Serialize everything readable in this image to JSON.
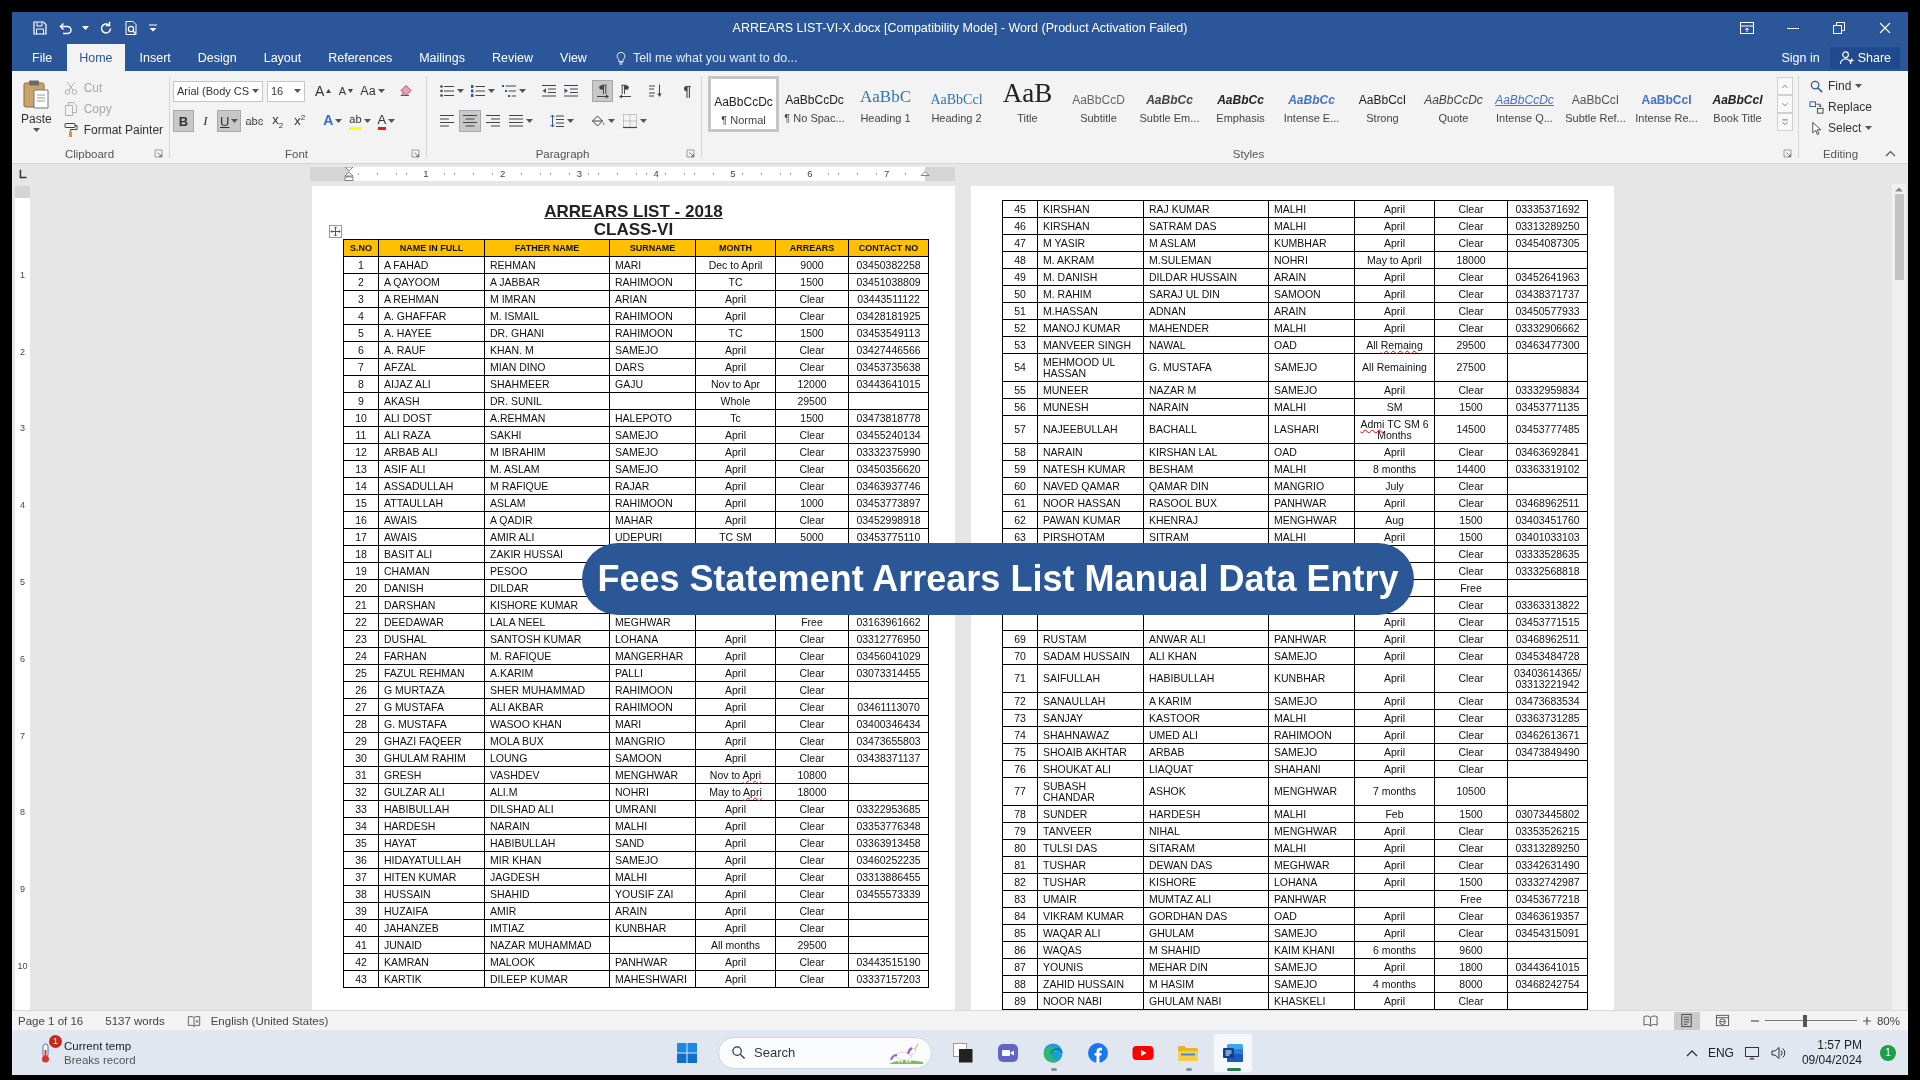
{
  "window": {
    "title": "ARREARS LIST-VI-X.docx [Compatibility Mode] - Word (Product Activation Failed)"
  },
  "ribbon_tabs": [
    {
      "label": "File",
      "selected": false
    },
    {
      "label": "Home",
      "selected": true
    },
    {
      "label": "Insert",
      "selected": false
    },
    {
      "label": "Design",
      "selected": false
    },
    {
      "label": "Layout",
      "selected": false
    },
    {
      "label": "References",
      "selected": false
    },
    {
      "label": "Mailings",
      "selected": false
    },
    {
      "label": "Review",
      "selected": false
    },
    {
      "label": "View",
      "selected": false
    }
  ],
  "tell_me": {
    "placeholder": "Tell me what you want to do..."
  },
  "account": {
    "sign_in": "Sign in",
    "share": "Share"
  },
  "clipboard": {
    "label": "Clipboard",
    "paste": "Paste",
    "items": [
      {
        "kind": "cut",
        "label": "Cut",
        "disabled": true
      },
      {
        "kind": "copy",
        "label": "Copy",
        "disabled": true
      },
      {
        "kind": "painter",
        "label": "Format Painter",
        "disabled": false
      }
    ]
  },
  "font": {
    "label": "Font",
    "family": "Arial (Body CS",
    "size": "16",
    "size_buttons": [
      {
        "kind": "grow",
        "glyph": "A"
      },
      {
        "kind": "shrink",
        "glyph": "A"
      }
    ],
    "change_case": "Aa",
    "formats": [
      {
        "kind": "bold",
        "glyph": "B",
        "selected": true
      },
      {
        "kind": "italic",
        "glyph": "I",
        "selected": false
      },
      {
        "kind": "underline",
        "glyph": "U",
        "selected": true
      },
      {
        "kind": "strike",
        "glyph": "abc",
        "selected": false
      },
      {
        "kind": "subscript",
        "glyph": "x$_{2}$",
        "selected": false
      },
      {
        "kind": "superscript",
        "glyph": "x$^{2}$",
        "selected": false
      }
    ],
    "effects": [
      {
        "kind": "text_effects",
        "glyph": "A"
      },
      {
        "kind": "highlight",
        "glyph": "ab"
      },
      {
        "kind": "font_color",
        "glyph": "A"
      }
    ]
  },
  "paragraph": {
    "label": "Paragraph",
    "rows": [
      [
        {
          "kind": "bullets",
          "selected": false
        },
        {
          "kind": "numbering",
          "selected": false
        },
        {
          "kind": "multilevel",
          "selected": false
        },
        {
          "kind": "outdent",
          "selected": false
        },
        {
          "kind": "indent",
          "selected": false
        },
        {
          "kind": "ltr",
          "selected": true
        },
        {
          "kind": "rtl",
          "selected": false
        },
        {
          "kind": "sort",
          "selected": false
        },
        {
          "kind": "marks",
          "glyph": "¶",
          "selected": false
        }
      ],
      [
        {
          "kind": "align_left",
          "selected": false
        },
        {
          "kind": "align_center",
          "selected": true
        },
        {
          "kind": "align_right",
          "selected": false
        },
        {
          "kind": "justify",
          "selected": false
        },
        {
          "kind": "line_spacing",
          "selected": false
        },
        {
          "kind": "shading",
          "selected": false
        },
        {
          "kind": "borders",
          "selected": false
        }
      ]
    ]
  },
  "styles": {
    "label": "Styles",
    "items": [
      {
        "kind": "normal",
        "preview": "AaBbCcDc",
        "name": "¶ Normal",
        "selected": true
      },
      {
        "kind": "no_spacing",
        "preview": "AaBbCcDc",
        "name": "¶ No Spac...",
        "selected": false
      },
      {
        "kind": "heading1",
        "preview": "AaBbC",
        "name": "Heading 1",
        "selected": false
      },
      {
        "kind": "heading2",
        "preview": "AaBbCcl",
        "name": "Heading 2",
        "selected": false
      },
      {
        "kind": "title",
        "preview": "AaB",
        "name": "Title",
        "selected": false
      },
      {
        "kind": "subtitle",
        "preview": "AaBbCcD",
        "name": "Subtitle",
        "selected": false
      },
      {
        "kind": "subtle_emphasis",
        "preview": "AaBbCc",
        "name": "Subtle Em...",
        "selected": false
      },
      {
        "kind": "emphasis",
        "preview": "AaBbCc",
        "name": "Emphasis",
        "selected": false
      },
      {
        "kind": "intense_emphasis",
        "preview": "AaBbCc",
        "name": "Intense E...",
        "selected": false
      },
      {
        "kind": "strong",
        "preview": "AaBbCcI",
        "name": "Strong",
        "selected": false
      },
      {
        "kind": "quote",
        "preview": "AaBbCcDc",
        "name": "Quote",
        "selected": false
      },
      {
        "kind": "intense_quote",
        "preview": "AaBbCcDc",
        "name": "Intense Q...",
        "selected": false
      },
      {
        "kind": "subtle_reference",
        "preview": "AaBbCcI",
        "name": "Subtle Ref...",
        "selected": false
      },
      {
        "kind": "intense_reference",
        "preview": "AaBbCcI",
        "name": "Intense Re...",
        "selected": false
      },
      {
        "kind": "book_title",
        "preview": "AaBbCcl",
        "name": "Book Title",
        "selected": false
      }
    ]
  },
  "editing": {
    "label": "Editing",
    "items": [
      {
        "kind": "find",
        "label": "Find"
      },
      {
        "kind": "replace",
        "label": "Replace"
      },
      {
        "kind": "select",
        "label": "Select"
      }
    ]
  },
  "ruler": {
    "numbers": [
      "1",
      "2",
      "3",
      "4",
      "5",
      "6",
      "7"
    ]
  },
  "vertical_ruler": {
    "numbers": [
      "1",
      "2",
      "3",
      "4",
      "5",
      "6",
      "7",
      "8",
      "9",
      "10"
    ]
  },
  "pages": [
    {
      "title": "ARREARS LIST - 2018",
      "subtitle": "CLASS-VI",
      "columns": [
        "S.NO",
        "NAME IN FULL",
        "FATHER NAME",
        "SURNAME",
        "MONTH",
        "ARREARS",
        "CONTACT NO"
      ],
      "rows": [
        {
          "no": "1",
          "name": "A FAHAD",
          "father": "REHMAN",
          "surname": "MARI",
          "month": "Dec to April",
          "arrears": "9000",
          "contact": "03450382258"
        },
        {
          "no": "2",
          "name": "A QAYOOM",
          "father": "A JABBAR",
          "surname": "RAHIMOON",
          "month": "TC",
          "arrears": "1500",
          "contact": "03451038809"
        },
        {
          "no": "3",
          "name": "A REHMAN",
          "father": "M IMRAN",
          "surname": "ARIAN",
          "month": "April",
          "arrears": "Clear",
          "contact": "03443511122"
        },
        {
          "no": "4",
          "name": "A. GHAFFAR",
          "father": "M. ISMAIL",
          "surname": "RAHIMOON",
          "month": "April",
          "arrears": "Clear",
          "contact": "03428181925"
        },
        {
          "no": "5",
          "name": "A. HAYEE",
          "father": "DR. GHANI",
          "surname": "RAHIMOON",
          "month": "TC",
          "arrears": "1500",
          "contact": "03453549113"
        },
        {
          "no": "6",
          "name": "A. RAUF",
          "father": "KHAN. M",
          "surname": "SAMEJO",
          "month": "April",
          "arrears": "Clear",
          "contact": "03427446566"
        },
        {
          "no": "7",
          "name": "AFZAL",
          "father": "MIAN DINO",
          "surname": "DARS",
          "month": "April",
          "arrears": "Clear",
          "contact": "03453735638"
        },
        {
          "no": "8",
          "name": "AIJAZ ALI",
          "father": "SHAHMEER",
          "surname": "GAJU",
          "month": "Nov to Apr",
          "arrears": "12000",
          "contact": "03443641015"
        },
        {
          "no": "9",
          "name": "AKASH",
          "father": "DR. SUNIL",
          "month": "Whole",
          "arrears": "29500"
        },
        {
          "no": "10",
          "name": "ALI DOST",
          "father": "A.REHMAN",
          "surname": "HALEPOTO",
          "month": "Tc",
          "arrears": "1500",
          "contact": "03473818778"
        },
        {
          "no": "11",
          "name": "ALI RAZA",
          "father": "SAKHI",
          "surname": "SAMEJO",
          "month": "April",
          "arrears": "Clear",
          "contact": "03455240134"
        },
        {
          "no": "12",
          "name": "ARBAB ALI",
          "father": "M IBRAHIM",
          "surname": "SAMEJO",
          "month": "April",
          "arrears": "Clear",
          "contact": "03332375990"
        },
        {
          "no": "13",
          "name": "ASIF ALI",
          "father": "M. ASLAM",
          "surname": "SAMEJO",
          "month": "April",
          "arrears": "Clear",
          "contact": "03450356620"
        },
        {
          "no": "14",
          "name": "ASSADULLAH",
          "father": "M RAFIQUE",
          "surname": "RAJAR",
          "month": "April",
          "arrears": "Clear",
          "contact": "03463937746"
        },
        {
          "no": "15",
          "name": "ATTAULLAH",
          "father": "ASLAM",
          "surname": "RAHIMOON",
          "month": "April",
          "arrears": "1000",
          "contact": "03453773897"
        },
        {
          "no": "16",
          "name": "AWAIS",
          "father": "A QADIR",
          "surname": "MAHAR",
          "month": "April",
          "arrears": "Clear",
          "contact": "03452998918"
        },
        {
          "no": "17",
          "name": "AWAIS",
          "father": "AMIR ALI",
          "surname": "UDEPURI",
          "month": "TC SM",
          "arrears": "5000",
          "contact": "03453775110"
        },
        {
          "no": "18",
          "name": "BASIT ALI",
          "father": "ZAKIR HUSSAI"
        },
        {
          "no": "19",
          "name": "CHAMAN",
          "father": "PESOO"
        },
        {
          "no": "20",
          "name": "DANISH",
          "father": "DILDAR"
        },
        {
          "no": "21",
          "name": "DARSHAN",
          "father": "KISHORE KUMAR"
        },
        {
          "no": "22",
          "name": "DEEDAWAR",
          "father": "LALA NEEL",
          "surname": "MEGHWAR",
          "arrears": "Free",
          "contact": "03163961662"
        },
        {
          "no": "23",
          "name": "DUSHAL",
          "father": "SANTOSH KUMAR",
          "surname": "LOHANA",
          "month": "April",
          "arrears": "Clear",
          "contact": "03312776950"
        },
        {
          "no": "24",
          "name": "FARHAN",
          "father": "M. RAFIQUE",
          "surname": "MANGERHAR",
          "month": "April",
          "arrears": "Clear",
          "contact": "03456041029"
        },
        {
          "no": "25",
          "name": "FAZUL REHMAN",
          "father": "A.KARIM",
          "surname": "PALLI",
          "month": "April",
          "arrears": "Clear",
          "contact": "03073314455"
        },
        {
          "no": "26",
          "name": "G MURTAZA",
          "father": "SHER MUHAMMAD",
          "surname": "RAHIMOON",
          "month": "April",
          "arrears": "Clear"
        },
        {
          "no": "27",
          "name": "G MUSTAFA",
          "father": "ALI AKBAR",
          "surname": "RAHIMOON",
          "month": "April",
          "arrears": "Clear",
          "contact": "03461113070"
        },
        {
          "no": "28",
          "name": "G. MUSTAFA",
          "father": "WASOO KHAN",
          "surname": "MARI",
          "month": "April",
          "arrears": "Clear",
          "contact": "03400346434"
        },
        {
          "no": "29",
          "name": "GHAZI FAQEER",
          "father": "MOLA BUX",
          "surname": "MANGRIO",
          "month": "April",
          "arrears": "Clear",
          "contact": "03473655803"
        },
        {
          "no": "30",
          "name": "GHULAM RAHIM",
          "father": "LOUNG",
          "surname": "SAMOON",
          "month": "April",
          "arrears": "Clear",
          "contact": "03438371137"
        },
        {
          "no": "31",
          "name": "GRESH",
          "father": "VASHDEV",
          "surname": "MENGHWAR",
          "month": [
            {
              "text": "Nov to",
              "misspelled": false
            },
            {
              "text": "Apri",
              "misspelled": true
            }
          ],
          "arrears": "10800"
        },
        {
          "no": "32",
          "name": "GULZAR ALI",
          "father": "ALI.M",
          "surname": "NOHRI",
          "month": [
            {
              "text": "May to",
              "misspelled": false
            },
            {
              "text": "Apri",
              "misspelled": true
            }
          ],
          "arrears": "18000"
        },
        {
          "no": "33",
          "name": "HABIBULLAH",
          "father": "DILSHAD ALI",
          "surname": "UMRANI",
          "month": "April",
          "arrears": "Clear",
          "contact": "03322953685"
        },
        {
          "no": "34",
          "name": "HARDESH",
          "father": "NARAIN",
          "surname": "MALHI",
          "month": "April",
          "arrears": "Clear",
          "contact": "03353776348"
        },
        {
          "no": "35",
          "name": "HAYAT",
          "father": "HABIBULLAH",
          "surname": "SAND",
          "month": "April",
          "arrears": "Clear",
          "contact": "03363913458"
        },
        {
          "no": "36",
          "name": "HIDAYATULLAH",
          "father": "MIR KHAN",
          "surname": "SAMEJO",
          "month": "April",
          "arrears": "Clear",
          "contact": "03460252235"
        },
        {
          "no": "37",
          "name": "HITEN KUMAR",
          "father": "JAGDESH",
          "surname": "MALHI",
          "month": "April",
          "arrears": "Clear",
          "contact": "03313886455"
        },
        {
          "no": "38",
          "name": "HUSSAIN",
          "father": "SHAHID",
          "surname": "YOUSIF ZAI",
          "month": "April",
          "arrears": "Clear",
          "contact": "03455573339"
        },
        {
          "no": "39",
          "name": "HUZAIFA",
          "father": "AMIR",
          "surname": "ARAIN",
          "month": "April",
          "arrears": "Clear"
        },
        {
          "no": "40",
          "name": "JAHANZEB",
          "father": "IMTIAZ",
          "surname": "KUNBHAR",
          "month": "April",
          "arrears": "Clear"
        },
        {
          "no": "41",
          "name": "JUNAID",
          "father": "NAZAR MUHAMMAD",
          "month": "All months",
          "arrears": "29500"
        },
        {
          "no": "42",
          "name": "KAMRAN",
          "father": "MALOOK",
          "surname": "PANHWAR",
          "month": "April",
          "arrears": "Clear",
          "contact": "03443515190"
        },
        {
          "no": "43",
          "name": "KARTIK",
          "father": "DILEEP KUMAR",
          "surname": "MAHESHWARI",
          "month": "April",
          "arrears": "Clear",
          "contact": "03337157203"
        }
      ]
    },
    {
      "rows": [
        {
          "no": "45",
          "name": "KIRSHAN",
          "father": "RAJ KUMAR",
          "surname": "MALHI",
          "month": "April",
          "arrears": "Clear",
          "contact": "03335371692"
        },
        {
          "no": "46",
          "name": "KIRSHAN",
          "father": "SATRAM DAS",
          "surname": "MALHI",
          "month": "April",
          "arrears": "Clear",
          "contact": "03313289250"
        },
        {
          "no": "47",
          "name": "M YASIR",
          "father": "M ASLAM",
          "surname": "KUMBHAR",
          "month": "April",
          "arrears": "Clear",
          "contact": "03454087305"
        },
        {
          "no": "48",
          "name": "M. AKRAM",
          "father": "M.SULEMAN",
          "surname": "NOHRI",
          "month": "May to April",
          "arrears": "18000"
        },
        {
          "no": "49",
          "name": "M. DANISH",
          "father": "DILDAR HUSSAIN",
          "surname": "ARAIN",
          "month": "April",
          "arrears": "Clear",
          "contact": "03452641963"
        },
        {
          "no": "50",
          "name": "M. RAHIM",
          "father": "SARAJ UL DIN",
          "surname": "SAMOON",
          "month": "April",
          "arrears": "Clear",
          "contact": "03438371737"
        },
        {
          "no": "51",
          "name": "M.HASSAN",
          "father": "ADNAN",
          "surname": "ARAIN",
          "month": "April",
          "arrears": "Clear",
          "contact": "03450577933"
        },
        {
          "no": "52",
          "name": "MANOJ KUMAR",
          "father": "MAHENDER",
          "surname": "MALHI",
          "month": "April",
          "arrears": "Clear",
          "contact": "03332906662"
        },
        {
          "no": "53",
          "name": "MANVEER SINGH",
          "father": "NAWAL",
          "surname": "OAD",
          "month": [
            {
              "text": "All",
              "misspelled": false
            },
            {
              "text": "Remaing",
              "misspelled": true
            }
          ],
          "arrears": "29500",
          "contact": "03463477300"
        },
        {
          "no": "54",
          "name": "MEHMOOD UL HASSAN",
          "father": "G. MUSTAFA",
          "surname": "SAMEJO",
          "month": "All Remaining",
          "arrears": "27500"
        },
        {
          "no": "55",
          "name": "MUNEER",
          "father": "NAZAR M",
          "surname": "SAMEJO",
          "month": "April",
          "arrears": "Clear",
          "contact": "03332959834"
        },
        {
          "no": "56",
          "name": "MUNESH",
          "father": "NARAIN",
          "surname": "MALHI",
          "month": "SM",
          "arrears": "1500",
          "contact": "03453771135"
        },
        {
          "no": "57",
          "name": "NAJEEBULLAH",
          "father": "BACHALL",
          "surname": "LASHARI",
          "month": [
            {
              "text": "Admi",
              "misspelled": true
            },
            {
              "text": "TC SM 6 Months",
              "misspelled": false
            }
          ],
          "arrears": "14500",
          "contact": "03453777485"
        },
        {
          "no": "58",
          "name": "NARAIN",
          "father": "KIRSHAN LAL",
          "surname": "OAD",
          "month": "April",
          "arrears": "Clear",
          "contact": "03463692841"
        },
        {
          "no": "59",
          "name": "NATESH KUMAR",
          "father": "BESHAM",
          "surname": "MALHI",
          "month": "8 months",
          "arrears": "14400",
          "contact": "03363319102"
        },
        {
          "no": "60",
          "name": "NAVED QAMAR",
          "father": "QAMAR DIN",
          "surname": "MANGRIO",
          "month": "July",
          "arrears": "Clear"
        },
        {
          "no": "61",
          "name": "NOOR HASSAN",
          "father": "RASOOL BUX",
          "surname": "PANHWAR",
          "month": "April",
          "arrears": "Clear",
          "contact": "03468962511"
        },
        {
          "no": "62",
          "name": "PAWAN KUMAR",
          "father": "KHENRAJ",
          "surname": "MENGHWAR",
          "month": "Aug",
          "arrears": "1500",
          "contact": "03403451760"
        },
        {
          "no": "63",
          "name": "PIRSHOTAM",
          "father": "SITRAM",
          "surname": "MALHI",
          "month": "April",
          "arrears": "1500",
          "contact": "03401033103"
        },
        {
          "arrears": "Clear",
          "contact": "03333528635"
        },
        {
          "arrears": "Clear",
          "contact": "03332568818"
        },
        {
          "arrears": "Free"
        },
        {
          "arrears": "Clear",
          "contact": "03363313822"
        },
        {
          "month": "April",
          "arrears": "Clear",
          "contact": "03453771515"
        },
        {
          "no": "69",
          "name": "RUSTAM",
          "father": "ANWAR ALI",
          "surname": "PANHWAR",
          "month": "April",
          "arrears": "Clear",
          "contact": "03468962511"
        },
        {
          "no": "70",
          "name": "SADAM HUSSAIN",
          "father": "ALI KHAN",
          "surname": "SAMEJO",
          "month": "April",
          "arrears": "Clear",
          "contact": "03453484728"
        },
        {
          "no": "71",
          "name": "SAIFULLAH",
          "father": "HABIBULLAH",
          "surname": "KUNBHAR",
          "month": "April",
          "arrears": "Clear",
          "contact": "03403614365/ 03313221942"
        },
        {
          "no": "72",
          "name": "SANAULLAH",
          "father": "A KARIM",
          "surname": "SAMEJO",
          "month": "April",
          "arrears": "Clear",
          "contact": "03473683534"
        },
        {
          "no": "73",
          "name": "SANJAY",
          "father": "KASTOOR",
          "surname": "MALHI",
          "month": "April",
          "arrears": "Clear",
          "contact": "03363731285"
        },
        {
          "no": "74",
          "name": "SHAHNAWAZ",
          "father": "UMED ALI",
          "surname": "RAHIMOON",
          "month": "April",
          "arrears": "Clear",
          "contact": "03462613671"
        },
        {
          "no": "75",
          "name": "SHOAIB AKHTAR",
          "father": "ARBAB",
          "surname": "SAMEJO",
          "month": "April",
          "arrears": "Clear",
          "contact": "03473849490"
        },
        {
          "no": "76",
          "name": "SHOUKAT ALI",
          "father": "LIAQUAT",
          "surname": "SHAHANI",
          "month": "April",
          "arrears": "Clear"
        },
        {
          "no": "77",
          "name": "SUBASH CHANDAR",
          "father": "ASHOK",
          "surname": "MENGHWAR",
          "month": "7 months",
          "arrears": "10500"
        },
        {
          "no": "78",
          "name": "SUNDER",
          "father": "HARDESH",
          "surname": "MALHI",
          "month": "Feb",
          "arrears": "1500",
          "contact": "03073445802"
        },
        {
          "no": "79",
          "name": "TANVEER",
          "father": "NIHAL",
          "surname": "MENGHWAR",
          "month": "April",
          "arrears": "Clear",
          "contact": "03353526215"
        },
        {
          "no": "80",
          "name": "TULSI DAS",
          "father": "SITARAM",
          "surname": "MALHI",
          "month": "April",
          "arrears": "Clear",
          "contact": "03313289250"
        },
        {
          "no": "81",
          "name": "TUSHAR",
          "father": "DEWAN DAS",
          "surname": "MEGHWAR",
          "month": "April",
          "arrears": "Clear",
          "contact": "03342631490"
        },
        {
          "no": "82",
          "name": "TUSHAR",
          "father": "KISHORE",
          "surname": "LOHANA",
          "month": "April",
          "arrears": "1500",
          "contact": "03332742987"
        },
        {
          "no": "83",
          "name": "UMAIR",
          "father": "MUMTAZ ALI",
          "surname": "PANHWAR",
          "arrears": "Free",
          "contact": "03453677218"
        },
        {
          "no": "84",
          "name": "VIKRAM KUMAR",
          "father": "GORDHAN DAS",
          "surname": "OAD",
          "month": "April",
          "arrears": "Clear",
          "contact": "03463619357"
        },
        {
          "no": "85",
          "name": "WAQAR ALI",
          "father": "GHULAM",
          "surname": "SAMEJO",
          "month": "April",
          "arrears": "Clear",
          "contact": "03454315091"
        },
        {
          "no": "86",
          "name": "WAQAS",
          "father": "M SHAHID",
          "surname": "KAIM KHANI",
          "month": "6 months",
          "arrears": "9600"
        },
        {
          "no": "87",
          "name": "YOUNIS",
          "father": "MEHAR DIN",
          "surname": "SAMEJO",
          "month": "April",
          "arrears": "1800",
          "contact": "03443641015"
        },
        {
          "no": "88",
          "name": "ZAHID HUSSAIN",
          "father": "M HASIM",
          "surname": "SAMEJO",
          "month": "4 months",
          "arrears": "8000",
          "contact": "03468242754"
        },
        {
          "no": "89",
          "name": "NOOR NABI",
          "father": "GHULAM NABI",
          "surname": "KHASKELI",
          "month": "April",
          "arrears": "Clear"
        }
      ]
    }
  ],
  "banner": {
    "text": "Fees Statement Arrears List Manual Data Entry"
  },
  "status_bar": {
    "page": "Page 1 of 16",
    "words": "5137 words",
    "language": "English (United States)",
    "views": [
      {
        "kind": "read",
        "selected": false
      },
      {
        "kind": "print",
        "selected": true
      },
      {
        "kind": "web",
        "selected": false
      }
    ],
    "zoom": {
      "level": 0.43,
      "reading": "80%"
    }
  },
  "taskbar": {
    "weather": {
      "badge": "1",
      "title": "Current temp",
      "subtitle": "Breaks record"
    },
    "search": {
      "placeholder": "Search"
    },
    "apps": [
      {
        "kind": "squares",
        "running": false,
        "active": false
      },
      {
        "kind": "meet",
        "running": false,
        "active": false
      },
      {
        "kind": "edge",
        "running": true,
        "active": false
      },
      {
        "kind": "facebook",
        "running": false,
        "active": false
      },
      {
        "kind": "youtube",
        "running": false,
        "active": false
      },
      {
        "kind": "explorer",
        "running": true,
        "active": false
      },
      {
        "kind": "word",
        "running": true,
        "active": true
      }
    ],
    "tray": {
      "language": "ENG",
      "time": "1:57 PM",
      "date": "09/04/2024",
      "notifications": "1"
    }
  }
}
